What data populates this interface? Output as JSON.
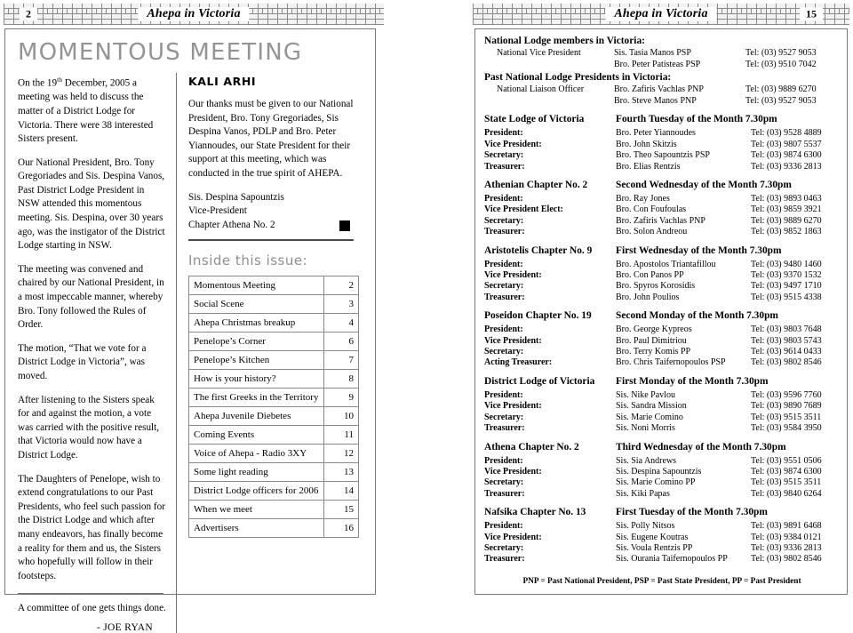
{
  "left_page": {
    "header": {
      "page_number": "2",
      "title": "Ahepa in Victoria"
    },
    "masthead": "MOMENTOUS MEETING",
    "article": {
      "paragraphs": [
        "On the 19th December, 2005 a meeting was held to discuss the matter of a District Lodge for Victoria.   There were 38 interested Sisters present.",
        "Our National President, Bro. Tony Gregoriades and Sis. Despina Vanos, Past District Lodge President in NSW attended this momentous meeting.  Sis. Despina, over 30 years ago, was the instigator of the District Lodge starting in NSW.",
        "The meeting was convened and chaired by our National President, in a most impeccable manner, whereby Bro. Tony followed the Rules of Order.",
        "The motion, “That we vote for a District Lodge in Victoria”, was moved.",
        "After listening to the Sisters speak for and against the motion, a vote was carried with the positive result, that Victoria would now have a District Lodge.",
        "The Daughters of Penelope, wish to extend congratulations to our Past Presidents, who feel such passion for the District Lodge and which after many endeavors, has finally become a reality for them and us, the Sisters who hopefully will follow in their footsteps."
      ],
      "p1_pre": "On the 19",
      "p1_sup": "th",
      "p1_post": " December, 2005 a meeting was held to discuss the matter of a District Lodge for Victoria.   There were 38 interested Sisters present.",
      "quote": "A committee of one gets things done.",
      "byline": "-  JOE RYAN"
    },
    "kali_arhi": {
      "heading": "KALI ARHI",
      "body": "Our thanks must be given to our National President, Bro. Tony Gregoriades, Sis Despina Vanos, PDLP and Bro. Peter Yiannoudes, our State President for their support at this meeting, which was conducted in the true spirit of AHEPA.",
      "sign_name": "Sis. Despina  Sapountzis",
      "sign_role": "Vice-President",
      "sign_chapter": "Chapter Athena No. 2"
    },
    "inside_this_issue": {
      "heading": "Inside this issue:",
      "entries": [
        {
          "title": "Momentous Meeting",
          "page": "2"
        },
        {
          "title": "Social Scene",
          "page": "3"
        },
        {
          "title": "Ahepa Christmas breakup",
          "page": "4"
        },
        {
          "title": "Penelope’s Corner",
          "page": "6"
        },
        {
          "title": "Penelope’s Kitchen",
          "page": "7"
        },
        {
          "title": "How is your history?",
          "page": "8"
        },
        {
          "title": "The first Greeks in the Territory",
          "page": "9"
        },
        {
          "title": "Ahepa Juvenile Diebetes",
          "page": "10"
        },
        {
          "title": "Coming Events",
          "page": "11"
        },
        {
          "title": "Voice of Ahepa  -  Radio 3XY",
          "page": "12"
        },
        {
          "title": "Some light reading",
          "page": "13"
        },
        {
          "title": "District Lodge officers for 2006",
          "page": "14"
        },
        {
          "title": "When we meet",
          "page": "15"
        },
        {
          "title": "Advertisers",
          "page": "16"
        }
      ]
    }
  },
  "right_page": {
    "header": {
      "page_number": "15",
      "title": "Ahepa in Victoria"
    },
    "national_lodge": {
      "title": "National Lodge members in Victoria:",
      "rows": [
        {
          "role": "National Vice President",
          "name": "Sis.  Tasia Manos  PSP",
          "tel": "Tel: (03) 9527 9053"
        },
        {
          "role": "",
          "name": "Bro. Peter Patisteas PSP",
          "tel": "Tel: (03) 9510 7042"
        }
      ]
    },
    "past_national": {
      "title": "Past National Lodge Presidents in Victoria:",
      "rows": [
        {
          "role": "National Liaison Officer",
          "name": "Bro. Zafiris Vachlas PNP",
          "tel": "Tel: (03) 9889 6270"
        },
        {
          "role": "",
          "name": "Bro. Steve Manos PNP",
          "tel": "Tel: (03) 9527 9053"
        }
      ]
    },
    "groups": [
      {
        "name": "State Lodge of Victoria",
        "meeting": "Fourth Tuesday of the Month  7.30pm",
        "officers": [
          {
            "role": "President:",
            "name": "Bro. Peter Yiannoudes",
            "tel": "Tel: (03) 9528 4889"
          },
          {
            "role": "Vice President:",
            "name": "Bro. John Skitzis",
            "tel": "Tel: (03) 9807 5537"
          },
          {
            "role": "Secretary:",
            "name": "Bro. Theo Sapountzis  PSP",
            "tel": "Tel: (03) 9874 6300"
          },
          {
            "role": "Treasurer:",
            "name": "Bro. Elias Rentzis",
            "tel": "Tel: (03) 9336 2813"
          }
        ]
      },
      {
        "name": "Athenian Chapter No. 2",
        "meeting": "Second Wednesday of the Month  7.30pm",
        "officers": [
          {
            "role": "President:",
            "name": "Bro. Ray Jones",
            "tel": "Tel: (03) 9893 0463"
          },
          {
            "role": "Vice President Elect:",
            "name": "Bro. Con Foufoulas",
            "tel": "Tel: (03) 9859 3921"
          },
          {
            "role": "Secretary:",
            "name": "Bro. Zafiris Vachlas PNP",
            "tel": "Tel: (03) 9889 6270"
          },
          {
            "role": "Treasurer:",
            "name": "Bro. Solon Andreou",
            "tel": "Tel: (03) 9852 1863"
          }
        ]
      },
      {
        "name": "Aristotelis Chapter No. 9",
        "meeting": "First Wednesday of the Month  7.30pm",
        "officers": [
          {
            "role": "President:",
            "name": "Bro.  Apostolos Triantafillou",
            "tel": "Tel: (03) 9480 1460"
          },
          {
            "role": "Vice President:",
            "name": "Bro.  Con Panos PP",
            "tel": "Tel: (03) 9370 1532"
          },
          {
            "role": "Secretary:",
            "name": "Bro.  Spyros Korosidis",
            "tel": "Tel: (03) 9497 1710"
          },
          {
            "role": "Treasurer:",
            "name": "Bro.  John Poulios",
            "tel": "Tel: (03) 9515 4338"
          }
        ]
      },
      {
        "name": "Poseidon Chapter No. 19",
        "meeting": "Second Monday of the Month  7.30pm",
        "officers": [
          {
            "role": "President:",
            "name": "Bro. George Kypreos",
            "tel": "Tel: (03)  9803 7648"
          },
          {
            "role": "Vice President:",
            "name": "Bro. Paul Dimitriou",
            "tel": "Tel: (03)  9803 5743"
          },
          {
            "role": "Secretary:",
            "name": "Bro. Terry Komis PP",
            "tel": "Tel: (03)  9614 0433"
          },
          {
            "role": "Acting Treasurer:",
            "name": "Bro. Chris Taifernopoulos PSP",
            "tel": "Tel: (03)  9802 8546"
          }
        ]
      },
      {
        "name": "District Lodge of Victoria",
        "meeting": "First Monday of the Month  7.30pm",
        "officers": [
          {
            "role": "President:",
            "name": "Sis. Nike Pavlou",
            "tel": "Tel: (03) 9596 7760"
          },
          {
            "role": "Vice President:",
            "name": "Sis. Sandra Mission",
            "tel": "Tel: (03) 9890 7689"
          },
          {
            "role": "Secretary:",
            "name": "Sis. Marie Comino",
            "tel": "Tel: (03) 9515 3511"
          },
          {
            "role": "Treasurer:",
            "name": "Sis. Noni Morris",
            "tel": "Tel: (03) 9584 3950"
          }
        ]
      },
      {
        "name": "Athena Chapter No. 2",
        "meeting": "Third Wednesday of the Month  7.30pm",
        "officers": [
          {
            "role": "President:",
            "name": "Sis. Sia Andrews",
            "tel": "Tel: (03) 9551 0506"
          },
          {
            "role": "Vice President:",
            "name": "Sis. Despina Sapountzis",
            "tel": "Tel: (03) 9874 6300"
          },
          {
            "role": "Secretary:",
            "name": "Sis. Marie Comino PP",
            "tel": "Tel: (03) 9515 3511"
          },
          {
            "role": "Treasurer:",
            "name": "Sis. Kiki Papas",
            "tel": "Tel: (03) 9840 6264"
          }
        ]
      },
      {
        "name": "Nafsika Chapter No. 13",
        "meeting": "First Tuesday of the Month  7.30pm",
        "officers": [
          {
            "role": "President:",
            "name": "Sis. Polly Nitsos",
            "tel": "Tel: (03)  9891 6468"
          },
          {
            "role": "Vice President:",
            "name": "Sis. Eugene Koutras",
            "tel": "Tel: (03)  9384 0121"
          },
          {
            "role": "Secretary:",
            "name": "Sis. Voula Rentzis PP",
            "tel": "Tel: (03)  9336 2813"
          },
          {
            "role": "Treasurer:",
            "name": "Sis. Ourania Taifernopoulos PP",
            "tel": "Tel: (03)  9802 8546"
          }
        ]
      }
    ],
    "legend": "PNP = Past National President,  PSP = Past State President,  PP = Past President"
  }
}
